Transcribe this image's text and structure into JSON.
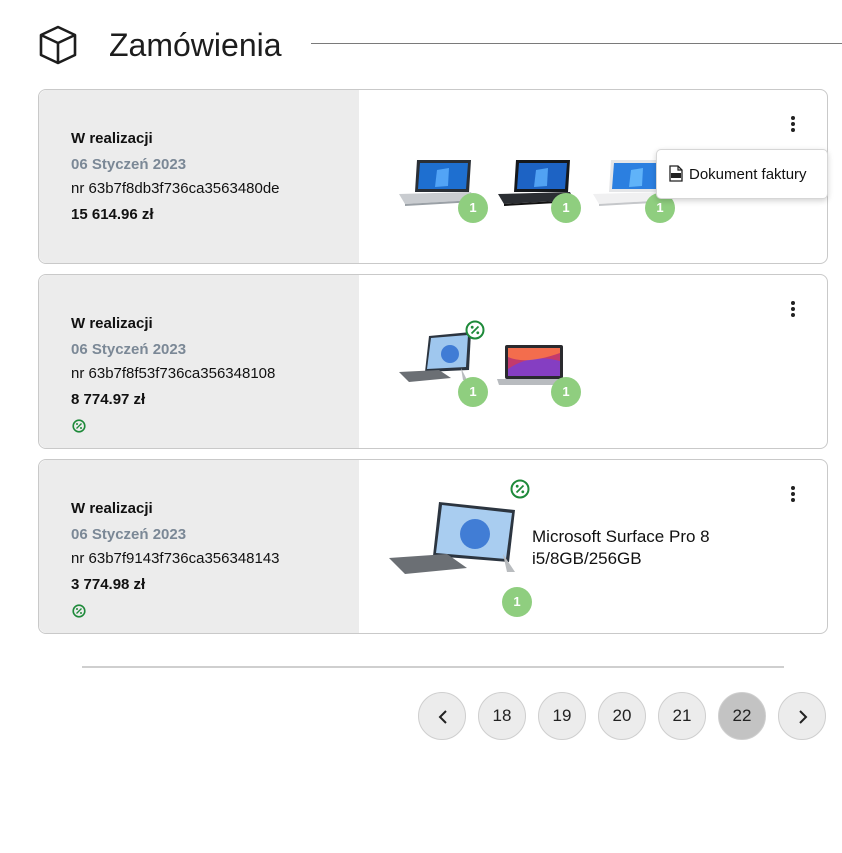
{
  "header": {
    "title": "Zamówienia",
    "icon": "box-icon"
  },
  "orders": [
    {
      "status": "W realizacji",
      "date": "06 Styczeń 2023",
      "number": "nr 63b7f8db3f736ca3563480de",
      "price": "15 614.96 zł",
      "promo": false,
      "products": [
        {
          "image": "laptop-silver",
          "qty": "1"
        },
        {
          "image": "laptop-black",
          "qty": "1"
        },
        {
          "image": "laptop-white",
          "qty": "1"
        }
      ],
      "menu_open": true
    },
    {
      "status": "W realizacji",
      "date": "06 Styczeń 2023",
      "number": "nr 63b7f8f53f736ca356348108",
      "price": "8 774.97 zł",
      "promo": true,
      "products": [
        {
          "image": "surface-tablet",
          "qty": "1",
          "promo": true
        },
        {
          "image": "macbook",
          "qty": "1"
        }
      ]
    },
    {
      "status": "W realizacji",
      "date": "06 Styczeń 2023",
      "number": "nr 63b7f9143f736ca356348143",
      "price": "3 774.98 zł",
      "promo": true,
      "products": [
        {
          "image": "surface-tablet",
          "qty": "1",
          "promo": true,
          "name_line1": "Microsoft Surface Pro 8",
          "name_line2": "i5/8GB/256GB"
        }
      ]
    }
  ],
  "popup": {
    "label": "Dokument faktury",
    "icon": "pdf-icon"
  },
  "pagination": {
    "pages": [
      "18",
      "19",
      "20",
      "21",
      "22"
    ],
    "active": "22",
    "prev_icon": "chevron-left-icon",
    "next_icon": "chevron-right-icon"
  },
  "colors": {
    "accent_green": "#8fce7f",
    "promo_green": "#1e8a3a",
    "panel_gray": "#ececec",
    "date_gray": "#7b8896"
  }
}
